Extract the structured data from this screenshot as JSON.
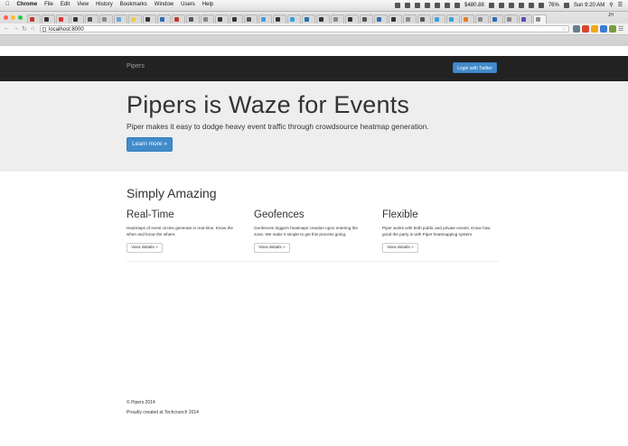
{
  "menubar": {
    "app_name": "Chrome",
    "items": [
      "File",
      "Edit",
      "View",
      "History",
      "Bookmarks",
      "Window",
      "Users",
      "Help"
    ],
    "price": "$480.88",
    "battery": "76%",
    "clock": "Sun 9:20 AM"
  },
  "browser": {
    "url": "localhost:8000",
    "user_badge": "JH"
  },
  "navbar": {
    "brand": "Pipers",
    "login_label": "Login with Twitter"
  },
  "hero": {
    "title": "Pipers is Waze for Events",
    "subtitle": "Piper makes it easy to dodge heavy event traffic through crowdsource heatmap generation.",
    "button_label": "Learn more »"
  },
  "features": {
    "section_title": "Simply Amazing",
    "items": [
      {
        "title": "Real-Time",
        "text": "Heatmaps of event circles generate in real-time. Know the when and know the where.",
        "button": "View details »"
      },
      {
        "title": "Geofences",
        "text": "Geofences triggers heatmaps creation upon entering the zone. We make it simple to get this process going.",
        "button": "View details »"
      },
      {
        "title": "Flexible",
        "text": "Piper works with both public and private events. Know how good the party is with Piper heatmapping system.",
        "button": "View details »"
      }
    ]
  },
  "footer": {
    "copyright": "© Pipers 2014",
    "credit": "Proudly created at Techcrunch 2014"
  },
  "colors": {
    "navbar_bg": "#222222",
    "jumbotron_bg": "#eeeeee",
    "primary": "#428bca"
  }
}
